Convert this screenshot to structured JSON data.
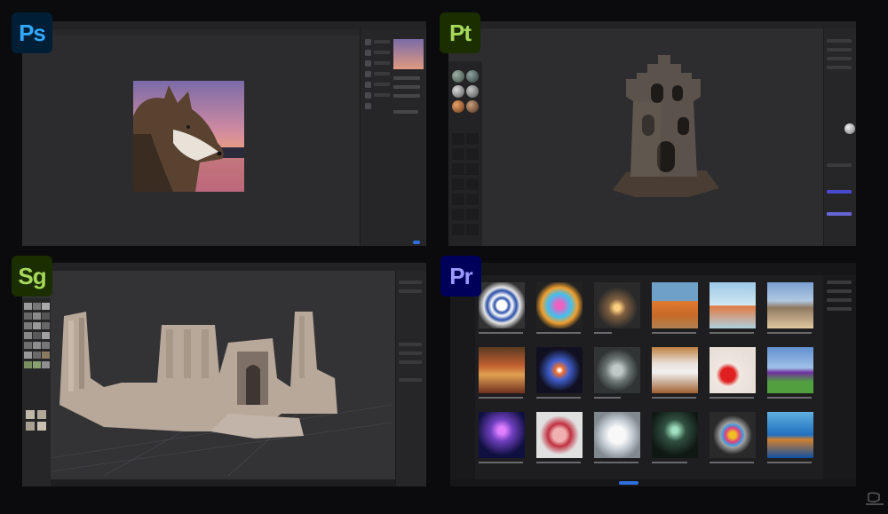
{
  "apps": {
    "photoshop": {
      "badge": "Ps",
      "badge_bg": "#001e36",
      "badge_fg": "#31a8ff"
    },
    "painter": {
      "badge": "Pt",
      "badge_bg": "#1a2e00",
      "badge_fg": "#a6d85b"
    },
    "stager": {
      "badge": "Sg",
      "badge_bg": "#1a2e00",
      "badge_fg": "#a6d85b"
    },
    "premiere": {
      "badge": "Pr",
      "badge_bg": "#00005b",
      "badge_fg": "#9999ff"
    }
  },
  "images": {
    "wolf": "wolf-portrait-sunset",
    "castle": "stone-tower-model",
    "ruins": "ancient-ruins-scene"
  },
  "premiere_grid": [
    [
      "blue-bowl",
      "neon-creature",
      "glowing-jar",
      "fox-guitar",
      "fox-winter",
      "cat-reading"
    ],
    [
      "wizard-cooking",
      "galaxy",
      "empty-jar",
      "panda-chef",
      "strawberries",
      "castle-field"
    ],
    [
      "jellyfish",
      "pig-scarf",
      "polar-bear",
      "forest-spirit",
      "glass-sphere",
      "teddy-wave"
    ]
  ],
  "brand": {
    "mark": "NVIDIA"
  }
}
